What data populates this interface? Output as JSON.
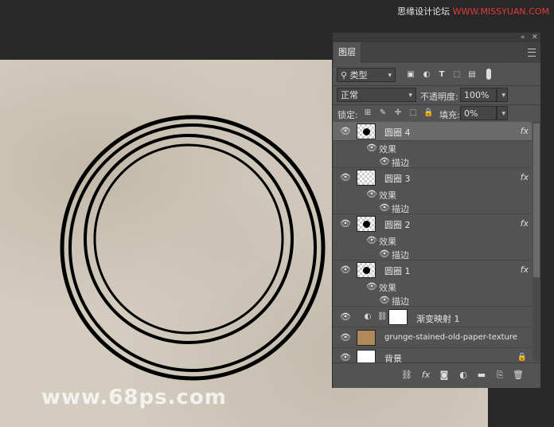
{
  "watermark_top": {
    "a": "思缘设计论坛",
    "b": "WWW.MISSYUAN.COM"
  },
  "watermark_bottom": "www.68ps.com",
  "panel": {
    "tab": "图层",
    "filter_kind": "类型",
    "blend_mode": "正常",
    "opacity_label": "不透明度:",
    "opacity_value": "100%",
    "lock_label": "锁定:",
    "fill_label": "填充:",
    "fill_value": "0%"
  },
  "layers": [
    {
      "name": "圆圈 4",
      "effects": "效果",
      "stroke": "描边",
      "fx": "fx"
    },
    {
      "name": "圆圈 3",
      "effects": "效果",
      "stroke": "描边",
      "fx": "fx"
    },
    {
      "name": "圆圈 2",
      "effects": "效果",
      "stroke": "描边",
      "fx": "fx"
    },
    {
      "name": "圆圈 1",
      "effects": "效果",
      "stroke": "描边",
      "fx": "fx"
    },
    {
      "name": "渐变映射 1"
    },
    {
      "name": "grunge-stained-old-paper-texture"
    },
    {
      "name": "背景"
    }
  ],
  "colors": {
    "panel_bg": "#535353",
    "selected_row": "#6a6a6a",
    "canvas_paper": "#d3ccbf",
    "ring": "#000000"
  }
}
